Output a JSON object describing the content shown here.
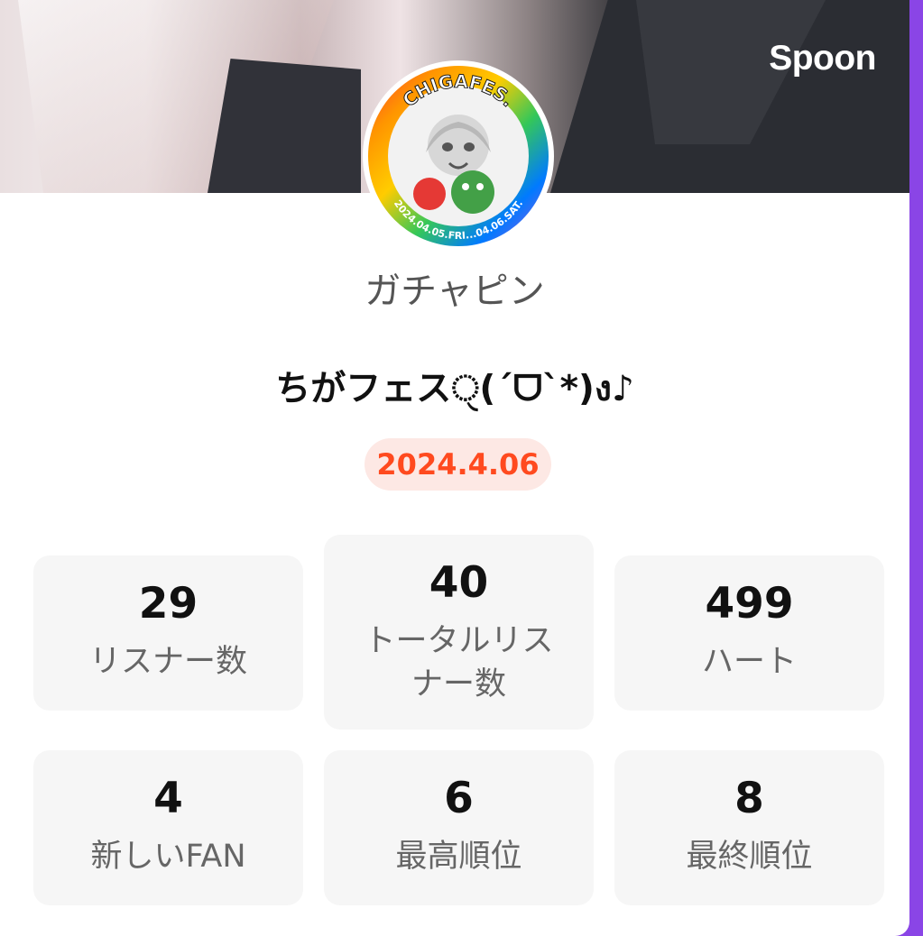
{
  "header": {
    "brand": "Spoon"
  },
  "profile": {
    "username": "ガチャピン",
    "avatar_badge": "CHIGAFES.",
    "avatar_dates": "2024.04.05.FRI...04.06.SAT."
  },
  "event": {
    "title": "ちがフェスੑ(´ᗜ`*)ง♪",
    "date": "2024.4.06"
  },
  "stats": {
    "listeners": {
      "value": "29",
      "label": "リスナー数"
    },
    "total_listeners": {
      "value": "40",
      "label_line1": "トータルリス",
      "label_line2": "ナー数"
    },
    "hearts": {
      "value": "499",
      "label": "ハート"
    },
    "new_fans": {
      "value": "4",
      "label": "新しいFAN"
    },
    "best_rank": {
      "value": "6",
      "label": "最高順位"
    },
    "final_rank": {
      "value": "8",
      "label": "最終順位"
    }
  },
  "colors": {
    "frame_gradient_start": "#a14fe8",
    "frame_gradient_end": "#8a45e6",
    "date_text": "#ff4a1f",
    "date_bg": "#fde8e4",
    "stat_bg": "#f6f6f6"
  }
}
